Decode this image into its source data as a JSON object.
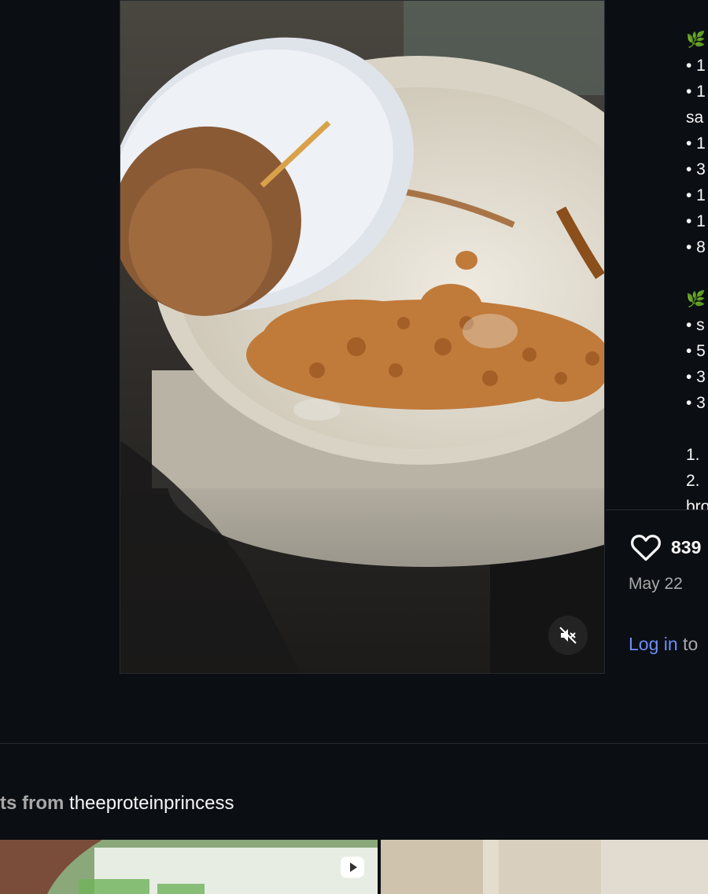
{
  "post": {
    "likes": "839",
    "date": "May 22",
    "login_link": "Log in",
    "login_suffix": " to"
  },
  "caption": {
    "leaf_icon": "herb-icon",
    "ingredients_a": [
      "• 1",
      "• 1",
      "sa",
      "• 1",
      "• 3",
      "• 1",
      "• 1",
      "• 8"
    ],
    "ingredients_b": [
      "• s",
      "• 5",
      "• 3",
      "• 3"
    ],
    "steps": [
      "1.",
      "2.",
      "bro"
    ]
  },
  "more_posts": {
    "prefix": "osts from",
    "username": "theeproteinprincess"
  },
  "colors": {
    "background": "#0b0e13",
    "link": "#6d8df7",
    "muted": "#a8a8a8",
    "leaf": "#5fb13a"
  }
}
